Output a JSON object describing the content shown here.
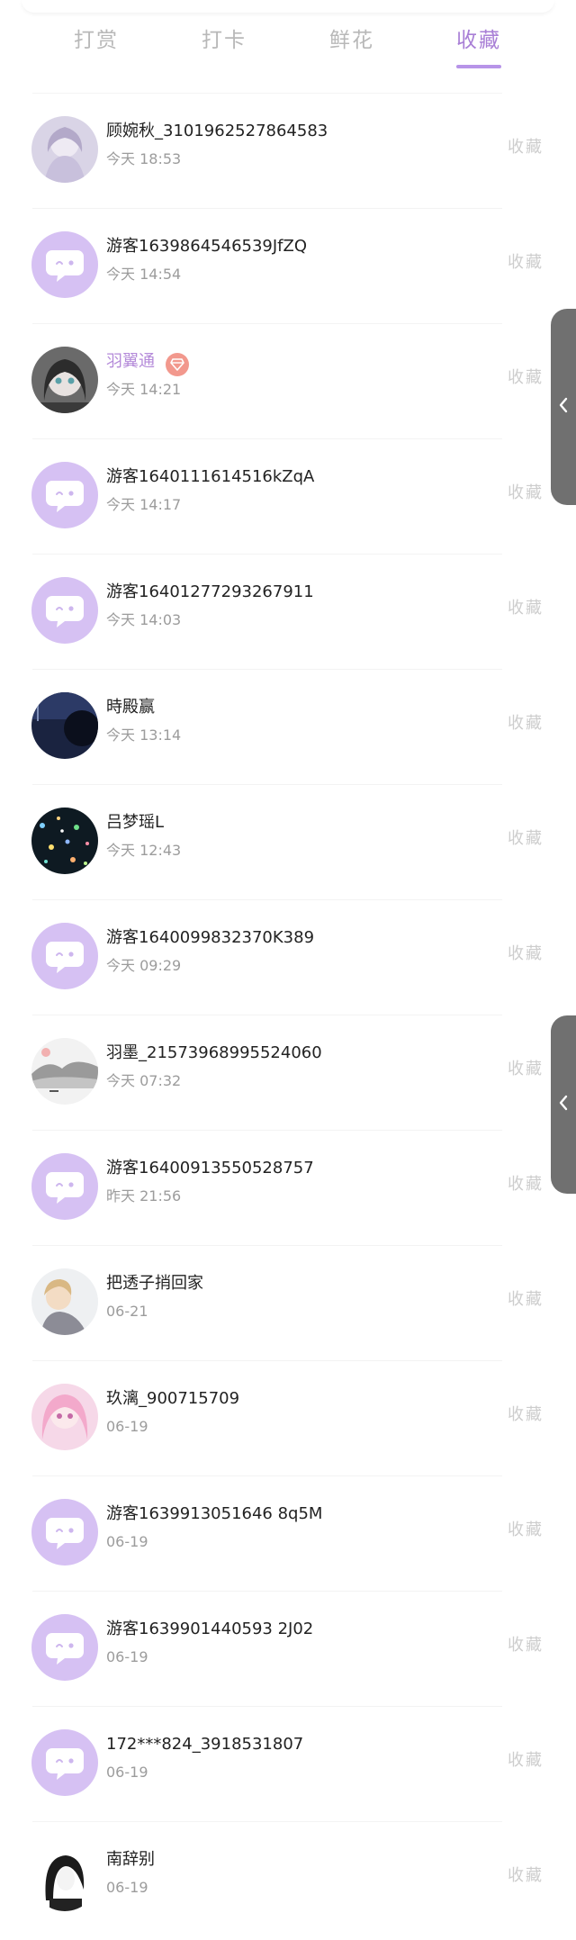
{
  "tabs": [
    {
      "label": "打赏",
      "active": false
    },
    {
      "label": "打卡",
      "active": false
    },
    {
      "label": "鲜花",
      "active": false
    },
    {
      "label": "收藏",
      "active": true
    }
  ],
  "colors": {
    "accent": "#a97fd6",
    "underline": "#b794e8",
    "guest_avatar_bg": "#d6c1f3",
    "vip_badge": "#f2988d",
    "side_tab": "#707070"
  },
  "items": [
    {
      "name": "顾婉秋_3101962527864583",
      "time": "今天 18:53",
      "action": "收藏",
      "avatar": "photo-girl-white"
    },
    {
      "name": "游客1639864546539JfZQ",
      "time": "今天 14:54",
      "action": "收藏",
      "avatar": "guest-chat-icon"
    },
    {
      "name": "羽翼通",
      "time": "今天 14:21",
      "action": "收藏",
      "avatar": "photo-anime-girl",
      "vip": true
    },
    {
      "name": "游客1640111614516kZqA",
      "time": "今天 14:17",
      "action": "收藏",
      "avatar": "guest-chat-icon"
    },
    {
      "name": "游客16401277293267911",
      "time": "今天 14:03",
      "action": "收藏",
      "avatar": "guest-chat-icon"
    },
    {
      "name": "時殿赢",
      "time": "今天 13:14",
      "action": "收藏",
      "avatar": "photo-dark-silhouette"
    },
    {
      "name": "吕梦瑶L",
      "time": "今天 12:43",
      "action": "收藏",
      "avatar": "photo-city-lights"
    },
    {
      "name": "游客1640099832370K389",
      "time": "今天 09:29",
      "action": "收藏",
      "avatar": "guest-chat-icon"
    },
    {
      "name": "羽墨_21573968995524060",
      "time": "今天 07:32",
      "action": "收藏",
      "avatar": "photo-ink-landscape"
    },
    {
      "name": "游客16400913550528757",
      "time": "昨天 21:56",
      "action": "收藏",
      "avatar": "guest-chat-icon"
    },
    {
      "name": "把透子捎回家",
      "time": "06-21",
      "action": "收藏",
      "avatar": "photo-anime-boy"
    },
    {
      "name": "玖漓_900715709",
      "time": "06-19",
      "action": "收藏",
      "avatar": "photo-pink-anime"
    },
    {
      "name": "游客1639913051646 8q5M",
      "time": "06-19",
      "action": "收藏",
      "avatar": "guest-chat-icon"
    },
    {
      "name": "游客1639901440593 2J02",
      "time": "06-19",
      "action": "收藏",
      "avatar": "guest-chat-icon"
    },
    {
      "name": "172***824_3918531807",
      "time": "06-19",
      "action": "收藏",
      "avatar": "guest-chat-icon"
    },
    {
      "name": "南辞别",
      "time": "06-19",
      "action": "收藏",
      "avatar": "photo-bw-girl"
    }
  ],
  "side_tabs": [
    {
      "icon": "chevron-left-icon"
    },
    {
      "icon": "chevron-left-icon"
    }
  ]
}
